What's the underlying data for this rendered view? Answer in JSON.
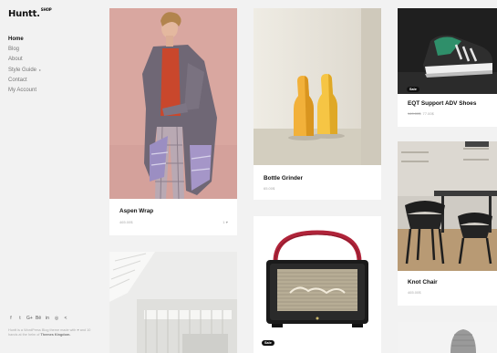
{
  "brand": {
    "name": "Huntt.",
    "suffix": "SHOP"
  },
  "nav": [
    {
      "label": "Home",
      "active": true
    },
    {
      "label": "Blog"
    },
    {
      "label": "About"
    },
    {
      "label": "Style Guide",
      "caret": "▸"
    },
    {
      "label": "Contact"
    },
    {
      "label": "My Account"
    }
  ],
  "social": [
    "f",
    "t",
    "G+",
    "Bē",
    "in",
    "◎",
    "<"
  ],
  "footer": {
    "text": "Huntt is a WordPress Blog theme made with ♥ and 10 hands at the helm of",
    "link": "Themes Kingdom."
  },
  "products": [
    {
      "title": "Aspen Wrap",
      "price": "465.00$",
      "likes": "1 ♥"
    },
    {
      "title": "Bottle Grinder",
      "price": "65.00$"
    },
    {
      "title": "EQT Support ADV Shoes",
      "old_price": "149.00$",
      "price": "77.00$",
      "badge": "Sale"
    },
    {
      "title": "Knot Chair",
      "price": "465.00$"
    },
    {
      "badge": "Sale"
    }
  ]
}
